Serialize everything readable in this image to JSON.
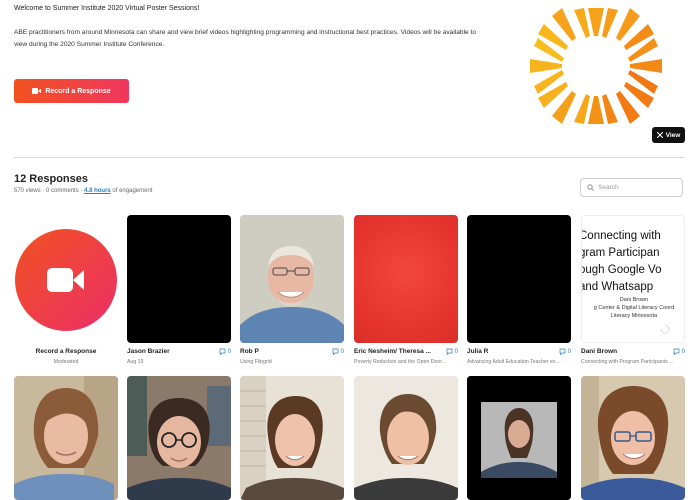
{
  "header": {
    "welcome": "Welcome to Summer Institute 2020 Virtual Poster Sessions!",
    "description": "ABE practitioners from around Minnesota can share and view brief videos highlighting programming and instructional best practices. Videos will be available to view during the 2020 Summer Institute Conference.",
    "record_button_label": "Record a Response",
    "view_button_label": "View"
  },
  "responses": {
    "title": "12 Responses",
    "views": "570 views",
    "comments": "0 comments",
    "engagement_value": "4.8 hours",
    "engagement_suffix": "of engagement",
    "search_placeholder": "Search"
  },
  "record_card": {
    "label": "Record a Response",
    "sub": "Moderated"
  },
  "cards": [
    {
      "name": "Jason Brazier",
      "sub": "Aug 19",
      "comments": "0"
    },
    {
      "name": "Rob P",
      "sub": "Using Flipgrid",
      "comments": "0"
    },
    {
      "name": "Eric Nesheim/ Theresa ...",
      "sub": "Poverty Reduction and the Open Door...",
      "comments": "0"
    },
    {
      "name": "Julia R",
      "sub": "Advancing Adult Education Teacher ex...",
      "comments": "0"
    },
    {
      "name": "Dani Brown",
      "sub": "Connecting with Program Participants ...",
      "comments": "0"
    }
  ],
  "slide": {
    "line1": "Connecting with",
    "line2": "gram Participan",
    "line3": "ough Google Vo",
    "line4": "and Whatsapp",
    "line5": "Dani Brown",
    "line6": "g Center & Digital Literacy Coord",
    "line7": "Literacy Minnesota"
  },
  "colors": {
    "accent_start": "#f0521f",
    "accent_end": "#ec2e6a",
    "link": "#2a7ec2",
    "logo_orange": "#f6a21b"
  }
}
